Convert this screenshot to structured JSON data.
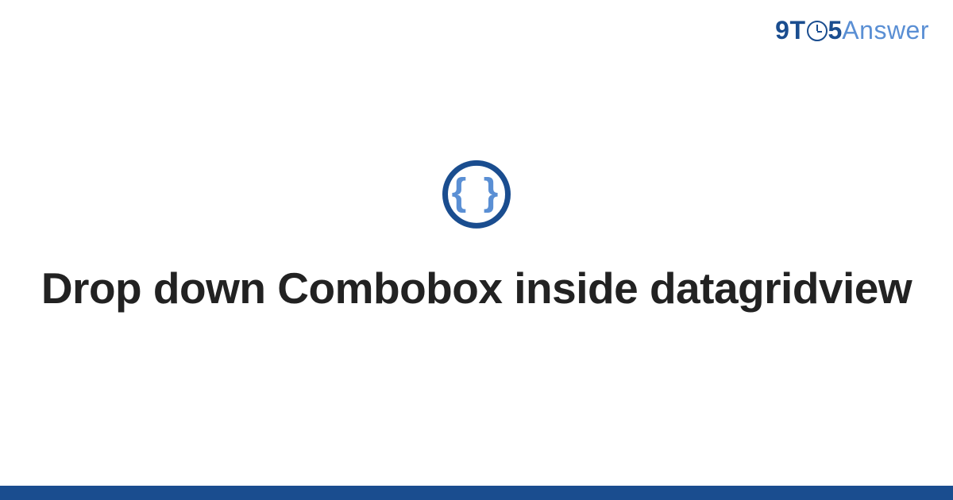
{
  "brand": {
    "part1": "9T",
    "part2": "5",
    "part3": "Answer"
  },
  "badge": {
    "glyph": "{ }"
  },
  "title": "Drop down Combobox inside datagridview",
  "colors": {
    "primary": "#1a4d8f",
    "secondary": "#5a8fd4",
    "text": "#222222"
  }
}
